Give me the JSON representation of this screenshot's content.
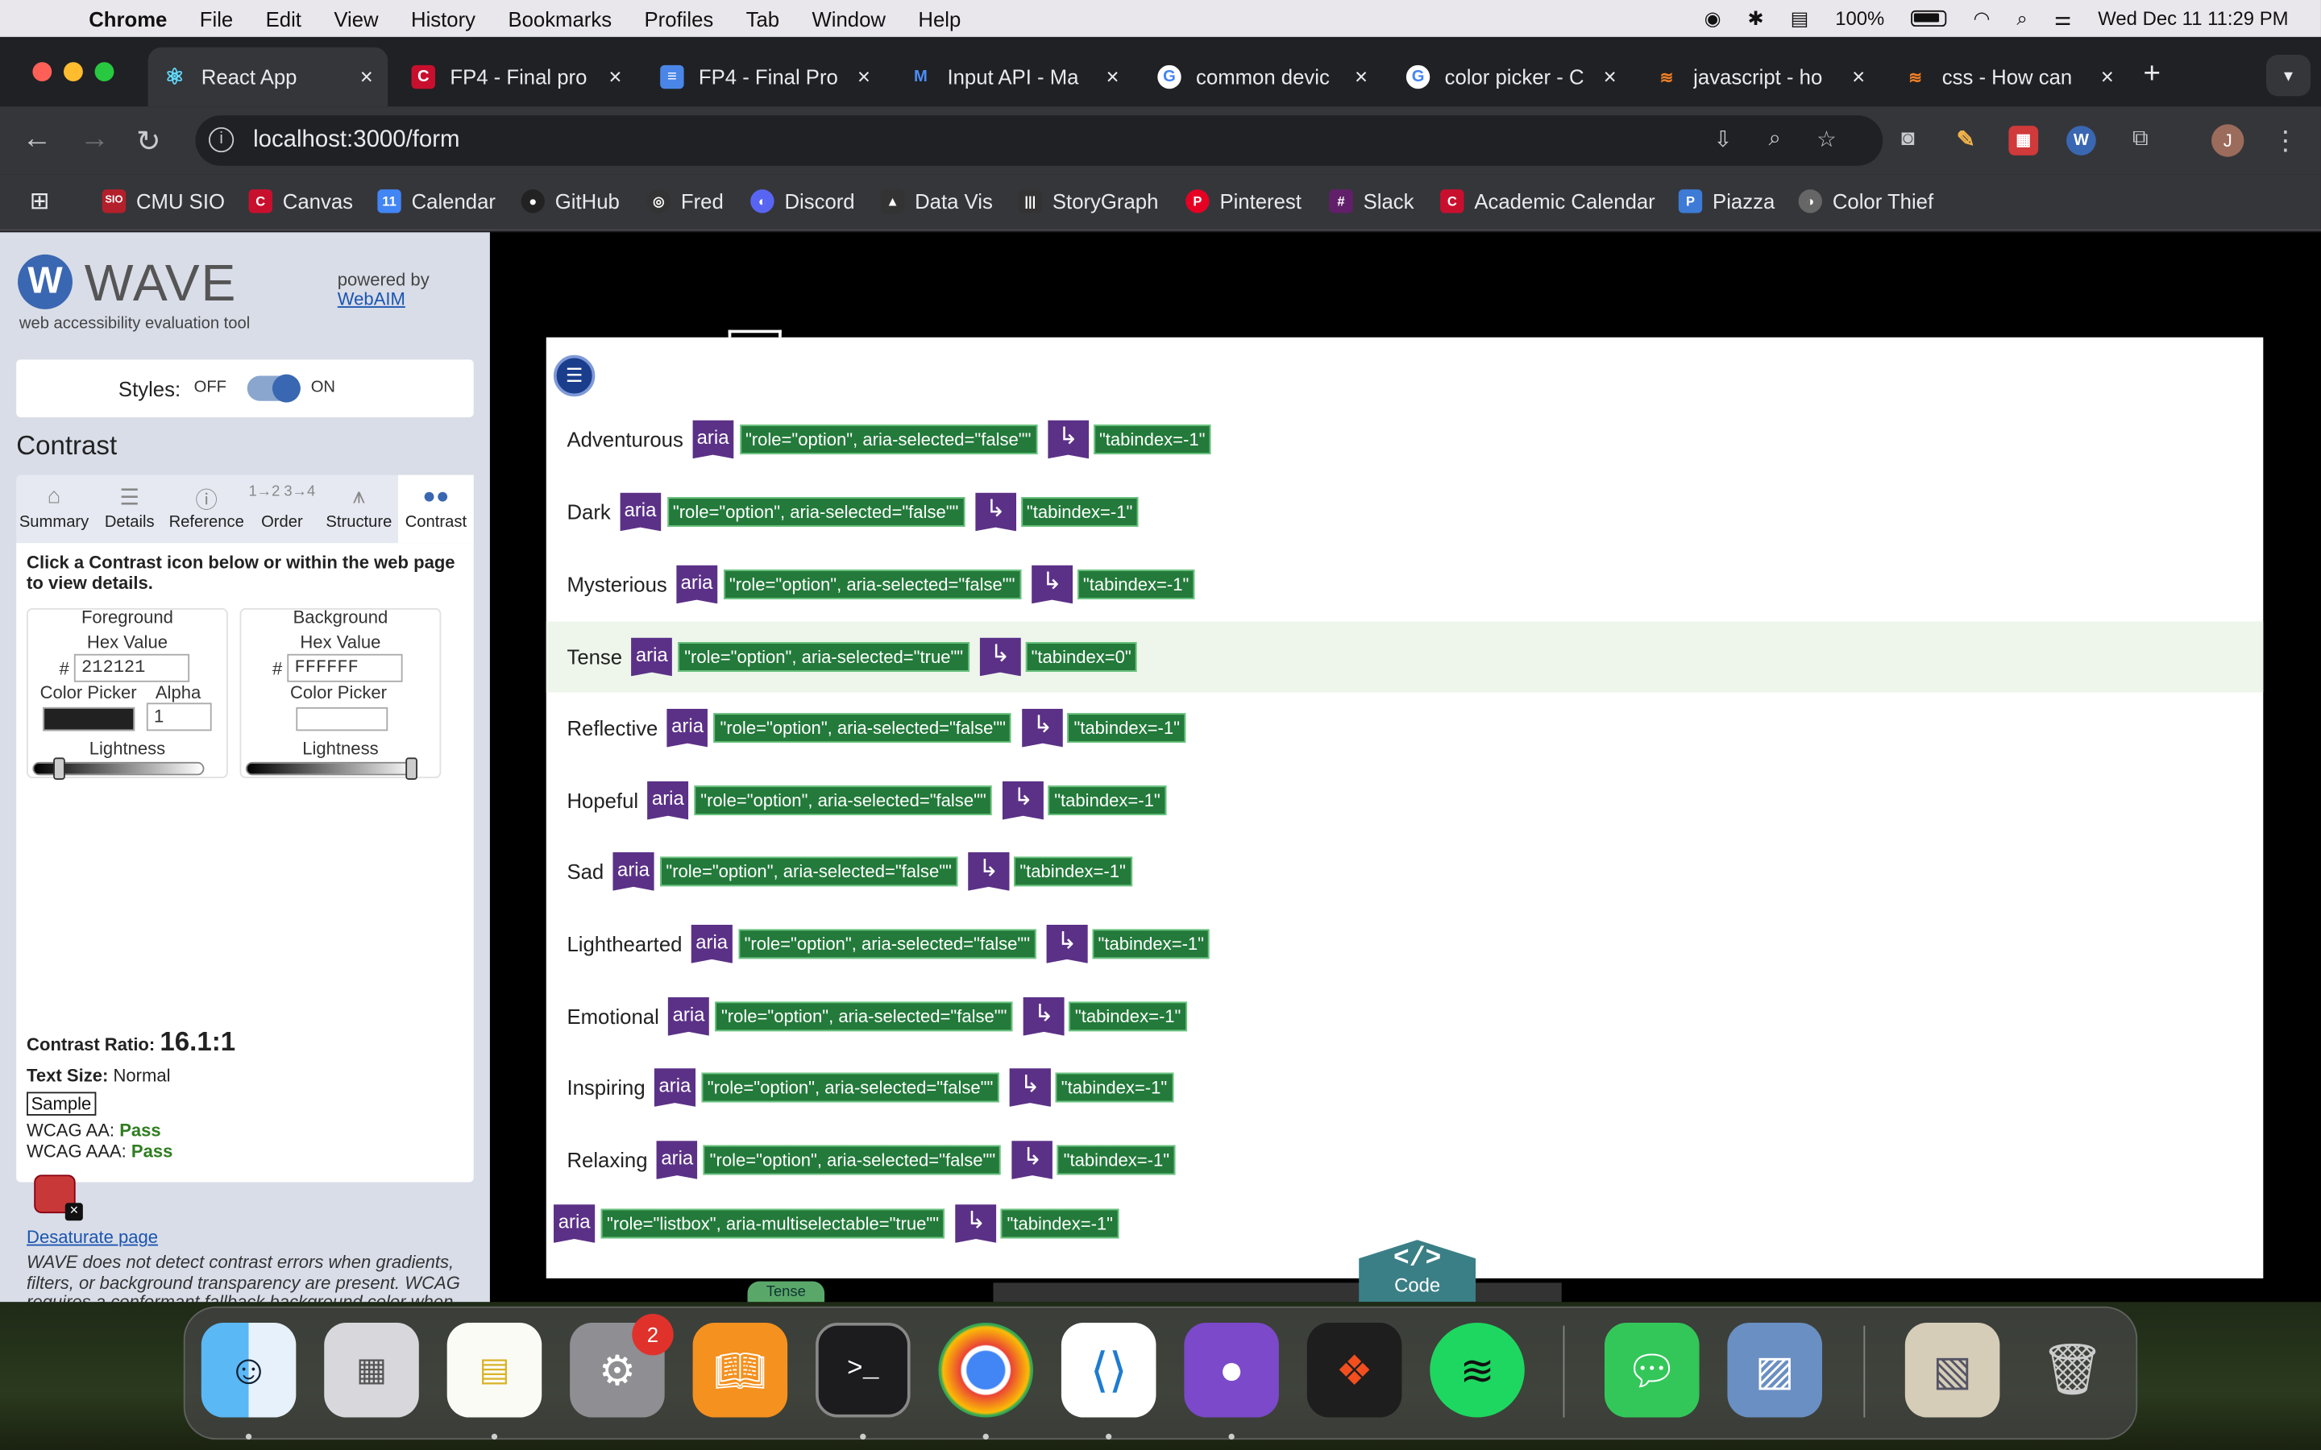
{
  "menubar": {
    "app": "Chrome",
    "items": [
      "File",
      "Edit",
      "View",
      "History",
      "Bookmarks",
      "Profiles",
      "Tab",
      "Window",
      "Help"
    ],
    "battery": "100%",
    "clock": "Wed Dec 11  11:29 PM"
  },
  "tabs": [
    {
      "title": "React App",
      "icon": "react-icon",
      "active": true
    },
    {
      "title": "FP4 - Final pro",
      "icon": "canvas-icon"
    },
    {
      "title": "FP4 - Final Pro",
      "icon": "docs-icon"
    },
    {
      "title": "Input API - Ma",
      "icon": "mui-icon"
    },
    {
      "title": "common devic",
      "icon": "google-icon"
    },
    {
      "title": "color picker - C",
      "icon": "google-icon"
    },
    {
      "title": "javascript - ho",
      "icon": "stackoverflow-icon"
    },
    {
      "title": "css - How can",
      "icon": "stackoverflow-icon"
    }
  ],
  "omnibox": {
    "url": "localhost:3000/form"
  },
  "bookmarks": [
    {
      "label": "CMU SIO",
      "color": "#b3202b",
      "badge": "SIO"
    },
    {
      "label": "Canvas",
      "color": "#c8102e",
      "badge": "C"
    },
    {
      "label": "Calendar",
      "color": "#4285f4",
      "badge": "11"
    },
    {
      "label": "GitHub",
      "color": "#222222",
      "badge": "●"
    },
    {
      "label": "Fred",
      "color": "#333333",
      "badge": "◎"
    },
    {
      "label": "Discord",
      "color": "#5865f2",
      "badge": "◐"
    },
    {
      "label": "Data Vis",
      "color": "#333333",
      "badge": "▲"
    },
    {
      "label": "StoryGraph",
      "color": "#333333",
      "badge": "|||"
    },
    {
      "label": "Pinterest",
      "color": "#e60023",
      "badge": "P"
    },
    {
      "label": "Slack",
      "color": "#611f69",
      "badge": "#"
    },
    {
      "label": "Academic Calendar",
      "color": "#c8102e",
      "badge": "C"
    },
    {
      "label": "Piazza",
      "color": "#3d7bd6",
      "badge": "P"
    },
    {
      "label": "Color Thief",
      "color": "#666666",
      "badge": "◑"
    }
  ],
  "wave": {
    "logo_letter": "W",
    "title": "WAVE",
    "subtitle": "web accessibility evaluation tool",
    "powered_by": "powered by",
    "webaim": "WebAIM",
    "styles_label": "Styles:",
    "styles_off": "OFF",
    "styles_on": "ON",
    "panel_title": "Contrast",
    "tabs": [
      "Summary",
      "Details",
      "Reference",
      "Order",
      "Structure",
      "Contrast"
    ],
    "instructions": "Click a Contrast icon below or within the web page to view details.",
    "foreground": {
      "label": "Foreground",
      "hex_label": "Hex Value",
      "hex": "212121",
      "picker_label": "Color Picker",
      "alpha_label": "Alpha",
      "alpha": "1",
      "lightness_label": "Lightness",
      "swatch": "#212121",
      "lightness": 0.13
    },
    "background": {
      "label": "Background",
      "hex_label": "Hex Value",
      "hex": "FFFFFF",
      "picker_label": "Color Picker",
      "lightness_label": "Lightness",
      "swatch": "#FFFFFF",
      "lightness": 1.0
    },
    "hash": "#",
    "contrast_ratio_label": "Contrast Ratio:",
    "contrast_ratio": "16.1:1",
    "text_size_label": "Text Size:",
    "text_size": "Normal",
    "sample": "Sample",
    "aa_label": "WCAG AA:",
    "aa": "Pass",
    "aaa_label": "WCAG AAA:",
    "aaa": "Pass",
    "desaturate": "Desaturate page",
    "note": "WAVE does not detect contrast errors when gradients, filters, or background transparency are present. WCAG requires a conformant fallback background color when background images are present. Use the Color Picker eye dropper to measure image contrasts."
  },
  "page": {
    "aria_label": "aria",
    "options": [
      {
        "name": "Adventurous",
        "role": "\"role=\"option\", aria-selected=\"false\"\"",
        "tabindex": "\"tabindex=-1\""
      },
      {
        "name": "Dark",
        "role": "\"role=\"option\", aria-selected=\"false\"\"",
        "tabindex": "\"tabindex=-1\""
      },
      {
        "name": "Mysterious",
        "role": "\"role=\"option\", aria-selected=\"false\"\"",
        "tabindex": "\"tabindex=-1\""
      },
      {
        "name": "Tense",
        "role": "\"role=\"option\", aria-selected=\"true\"\"",
        "tabindex": "\"tabindex=0\"",
        "selected": true
      },
      {
        "name": "Reflective",
        "role": "\"role=\"option\", aria-selected=\"false\"\"",
        "tabindex": "\"tabindex=-1\""
      },
      {
        "name": "Hopeful",
        "role": "\"role=\"option\", aria-selected=\"false\"\"",
        "tabindex": "\"tabindex=-1\""
      },
      {
        "name": "Sad",
        "role": "\"role=\"option\", aria-selected=\"false\"\"",
        "tabindex": "\"tabindex=-1\""
      },
      {
        "name": "Lighthearted",
        "role": "\"role=\"option\", aria-selected=\"false\"\"",
        "tabindex": "\"tabindex=-1\""
      },
      {
        "name": "Emotional",
        "role": "\"role=\"option\", aria-selected=\"false\"\"",
        "tabindex": "\"tabindex=-1\""
      },
      {
        "name": "Inspiring",
        "role": "\"role=\"option\", aria-selected=\"false\"\"",
        "tabindex": "\"tabindex=-1\""
      },
      {
        "name": "Relaxing",
        "role": "\"role=\"option\", aria-selected=\"false\"\"",
        "tabindex": "\"tabindex=-1\""
      }
    ],
    "listbox_role": "\"role=\"listbox\", aria-multiselectable=\"true\"\"",
    "listbox_tabindex": "\"tabindex=-1\"",
    "tense_stub": "Tense",
    "code_glyph": "</>",
    "code_label": "Code"
  },
  "dock": {
    "apps": [
      "finder-icon",
      "launchpad-icon",
      "notes-icon",
      "system-settings-icon",
      "books-icon",
      "terminal-icon",
      "chrome-icon",
      "vscode-icon",
      "github-desktop-icon",
      "figma-icon",
      "spotify-icon",
      "messages-icon",
      "preview-icon",
      "downloads-stack-icon",
      "trash-icon"
    ],
    "settings_badge": "2"
  }
}
